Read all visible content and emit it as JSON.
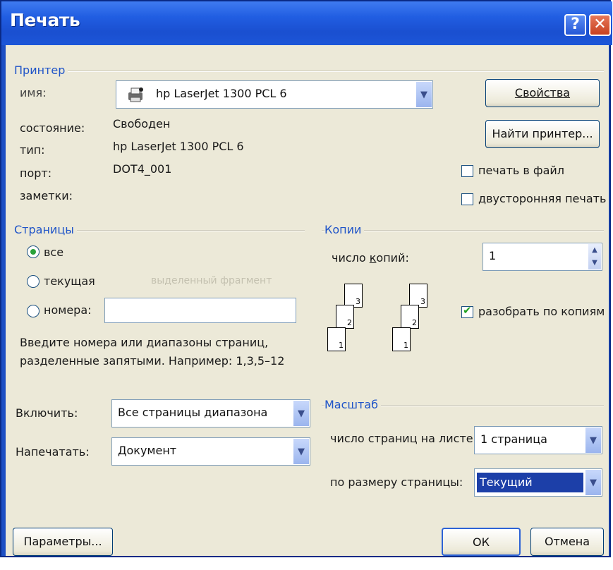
{
  "window": {
    "title": "Печать"
  },
  "printer": {
    "group_label": "Принтер",
    "name_label": "имя:",
    "name_value": "hp LaserJet 1300 PCL 6",
    "status_label": "состояние:",
    "status_value": "Свободен",
    "type_label": "тип:",
    "type_value": "hp LaserJet 1300 PCL 6",
    "port_label": "порт:",
    "port_value": "DOT4_001",
    "notes_label": "заметки:",
    "properties_button": "Свойства",
    "find_printer_button": "Найти принтер...",
    "print_to_file": {
      "label": "печать в файл",
      "checked": false
    },
    "duplex": {
      "label": "двусторонняя печать",
      "checked": false
    }
  },
  "pages": {
    "group_label": "Страницы",
    "all": {
      "label": "все",
      "selected": true
    },
    "current": {
      "label": "текущая",
      "selected": false
    },
    "selection": {
      "label": "выделенный фрагмент",
      "enabled": false
    },
    "numbers": {
      "label": "номера:",
      "selected": false,
      "value": ""
    },
    "hint_line1": "Введите номера или диапазоны страниц,",
    "hint_line2": "разделенные запятыми. Например: 1,3,5–12"
  },
  "copies": {
    "group_label": "Копии",
    "count_label": "число копий:",
    "count_value": "1",
    "collate": {
      "label": "разобрать по копиям",
      "checked": true
    },
    "sheet_numbers": [
      "1",
      "2",
      "3"
    ]
  },
  "include": {
    "label": "Включить:",
    "value": "Все страницы диапазона"
  },
  "print_what": {
    "label": "Напечатать:",
    "value": "Документ"
  },
  "scale": {
    "group_label": "Масштаб",
    "pages_per_sheet_label": "число страниц на листе:",
    "pages_per_sheet_value": "1 страница",
    "fit_to_label": "по размеру страницы:",
    "fit_to_value": "Текущий"
  },
  "footer": {
    "options_button": "Параметры...",
    "ok_button": "ОК",
    "cancel_button": "Отмена"
  },
  "colors": {
    "titlebar": "#215ee2",
    "dialog_bg": "#ece9d8",
    "group_label": "#1f54c8",
    "selection": "#1c3fa8"
  }
}
